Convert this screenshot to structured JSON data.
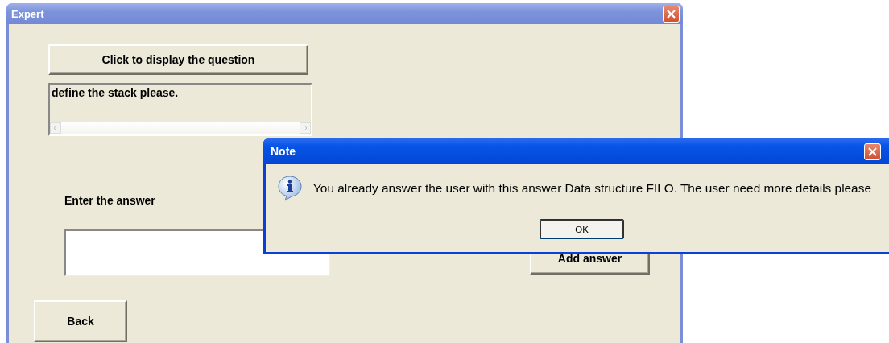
{
  "window": {
    "title": "Expert"
  },
  "question_button": {
    "label": "Click to display the question"
  },
  "question_box": {
    "value": "define the stack please."
  },
  "answer_label": "Enter the answer",
  "add_answer_button": {
    "label": "Add answer"
  },
  "back_button": {
    "label": "Back"
  },
  "dialog": {
    "title": "Note",
    "message": "You already answer the user with this answer Data structure FILO. The user need more details please",
    "ok_button": {
      "label": "OK"
    }
  }
}
